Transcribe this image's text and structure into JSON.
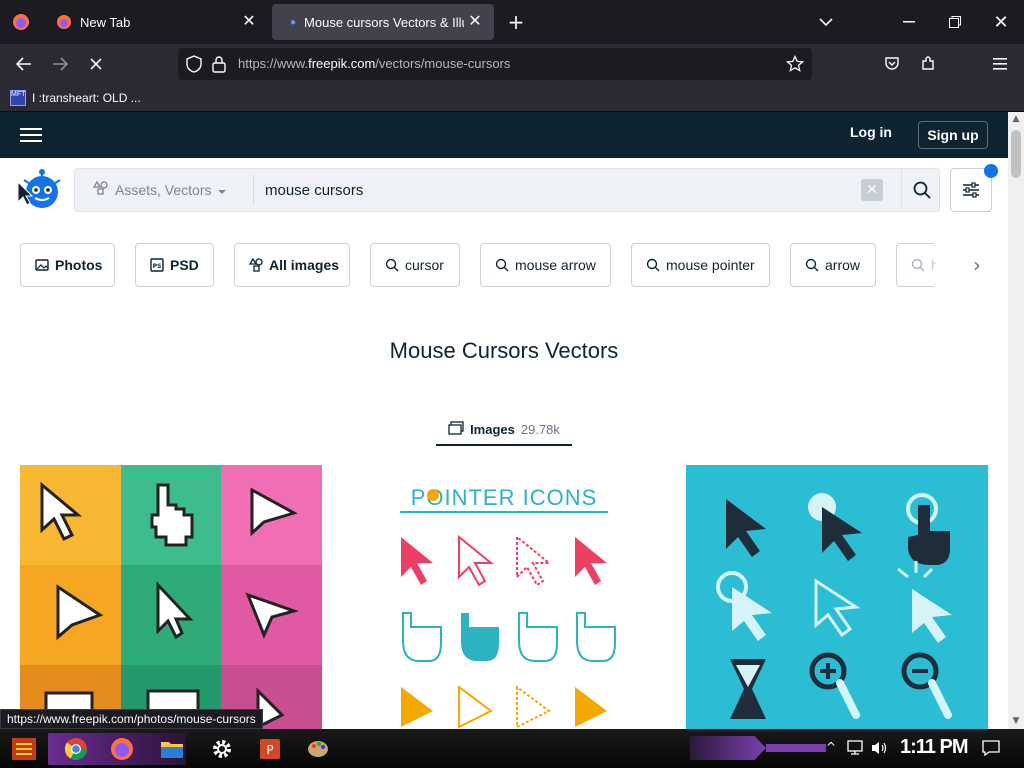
{
  "browser": {
    "tabs": [
      {
        "label": "New Tab",
        "active": false
      },
      {
        "label": "Mouse cursors Vectors & Illu",
        "active": true
      }
    ],
    "url_prefix": "https://www.",
    "url_host": "freepik.com",
    "url_path": "/vectors/mouse-cursors",
    "bookmark_label": "I :transheart: OLD ...",
    "bookmark_icon_text": "MFT"
  },
  "site": {
    "login_label": "Log in",
    "signup_label": "Sign up",
    "search": {
      "asset_type": "Assets, Vectors",
      "query": "mouse cursors"
    },
    "chips": [
      {
        "label": "Photos",
        "icon": "photo-icon"
      },
      {
        "label": "PSD",
        "icon": "psd-icon"
      },
      {
        "label": "All images",
        "icon": "shapes-icon"
      },
      {
        "label": "cursor",
        "icon": "search-icon"
      },
      {
        "label": "mouse arrow",
        "icon": "search-icon"
      },
      {
        "label": "mouse pointer",
        "icon": "search-icon"
      },
      {
        "label": "arrow",
        "icon": "search-icon"
      },
      {
        "label": "ha",
        "icon": "search-icon"
      }
    ],
    "page_title": "Mouse Cursors Vectors",
    "images_tab": {
      "label": "Images",
      "count": "29.78k"
    },
    "card2_heading": "POINTER ICONS"
  },
  "status_url": "https://www.freepik.com/photos/mouse-cursors",
  "taskbar": {
    "clock": "1:11 PM"
  },
  "colors": {
    "brand_dark": "#0e2431",
    "accent_blue": "#1273eb",
    "card3_bg": "#2bbdd4"
  }
}
